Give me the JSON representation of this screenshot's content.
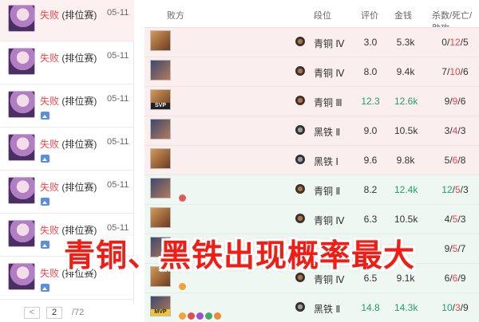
{
  "sidebar": {
    "matches": [
      {
        "result": "失败",
        "type": "(排位赛)",
        "date": "05-11",
        "has_image": false,
        "selected": true
      },
      {
        "result": "失败",
        "type": "(排位赛)",
        "date": "05-11",
        "has_image": false,
        "selected": false
      },
      {
        "result": "失败",
        "type": "(排位赛)",
        "date": "05-11",
        "has_image": true,
        "selected": false
      },
      {
        "result": "失败",
        "type": "(排位赛)",
        "date": "05-11",
        "has_image": true,
        "selected": false
      },
      {
        "result": "失败",
        "type": "(排位赛)",
        "date": "05-11",
        "has_image": true,
        "selected": false
      },
      {
        "result": "失败",
        "type": "(排位赛)",
        "date": "05-11",
        "has_image": true,
        "selected": false
      },
      {
        "result": "失败",
        "type": "(排位赛)",
        "date": "",
        "has_image": true,
        "selected": false
      }
    ],
    "pager": {
      "prev": "<",
      "current": "2",
      "total": "/72"
    }
  },
  "table": {
    "headers": {
      "team": "败方",
      "tier": "段位",
      "score": "评价",
      "gold": "金钱",
      "kda": "杀数/死亡/助攻"
    },
    "rows": [
      {
        "tier": "青铜 Ⅳ",
        "score": "3.0",
        "gold": "5.3k",
        "k": "0",
        "d": "12",
        "a": "5",
        "result": "lose",
        "badge": "",
        "minis": []
      },
      {
        "tier": "青铜 Ⅳ",
        "score": "8.0",
        "gold": "9.4k",
        "k": "7",
        "d": "10",
        "a": "6",
        "result": "lose",
        "badge": "",
        "minis": []
      },
      {
        "tier": "青铜 Ⅲ",
        "score": "12.3",
        "gold": "12.6k",
        "k": "9",
        "d": "9",
        "a": "6",
        "result": "lose",
        "badge": "SVP",
        "minis": []
      },
      {
        "tier": "黑铁 Ⅱ",
        "score": "9.0",
        "gold": "10.5k",
        "k": "3",
        "d": "4",
        "a": "3",
        "result": "lose",
        "badge": "",
        "minis": []
      },
      {
        "tier": "黑铁 Ⅰ",
        "score": "9.6",
        "gold": "9.8k",
        "k": "5",
        "d": "6",
        "a": "8",
        "result": "lose",
        "badge": "",
        "minis": []
      },
      {
        "tier": "青铜 Ⅱ",
        "score": "8.2",
        "gold": "12.4k",
        "k": "12",
        "d": "5",
        "a": "3",
        "result": "win",
        "badge": "",
        "minis": [
          "#e05a5a"
        ]
      },
      {
        "tier": "青铜 Ⅳ",
        "score": "6.3",
        "gold": "10.5k",
        "k": "4",
        "d": "5",
        "a": "3",
        "result": "win",
        "badge": "",
        "minis": []
      },
      {
        "tier": "",
        "score": "",
        "gold": "",
        "k": "9",
        "d": "5",
        "a": "7",
        "result": "win",
        "badge": "",
        "minis": []
      },
      {
        "tier": "青铜 Ⅳ",
        "score": "6.5",
        "gold": "9.1k",
        "k": "6",
        "d": "6",
        "a": "9",
        "result": "win",
        "badge": "",
        "minis": [
          "#f0a437"
        ]
      },
      {
        "tier": "黑铁 Ⅱ",
        "score": "14.8",
        "gold": "14.3k",
        "k": "10",
        "d": "3",
        "a": "9",
        "result": "win",
        "badge": "MVP",
        "minis": [
          "#f0a437",
          "#e0504b",
          "#9a52c8",
          "#46a86a",
          "#f08a2f"
        ]
      }
    ]
  },
  "caption": "青铜、黑铁出现概率最大"
}
